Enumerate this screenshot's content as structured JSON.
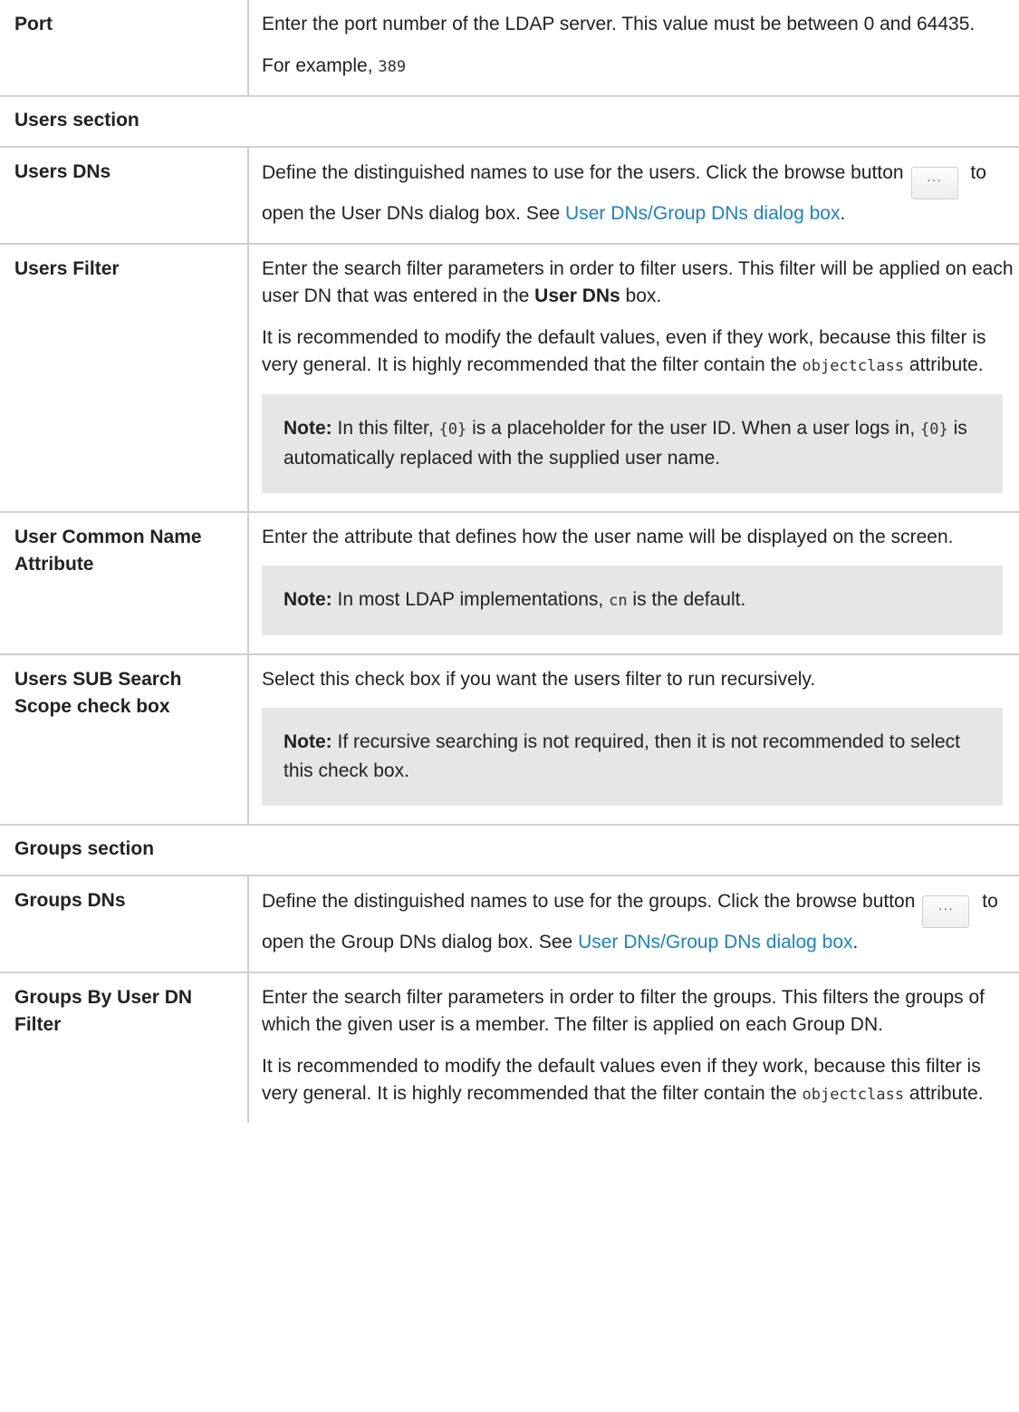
{
  "rows": {
    "port": {
      "label": "Port",
      "p1": "Enter the port number of the LDAP server. This value must be between 0 and 64435.",
      "p2_prefix": "For example, ",
      "p2_code": "389"
    },
    "users_section": {
      "label": "Users section"
    },
    "users_dns": {
      "label": "Users DNs",
      "text_a": "Define the distinguished names to use for the users. Click the browse button",
      "button_label": "···",
      "text_b": " to open the User DNs dialog box. See ",
      "link": "User DNs/Group DNs dialog box",
      "text_c": "."
    },
    "users_filter": {
      "label": "Users Filter",
      "p1_a": "Enter the search filter parameters in order to filter users. This filter will be applied on each user DN that was entered in the ",
      "p1_bold": "User DNs",
      "p1_b": " box.",
      "p2_a": "It is recommended to modify the default values, even if they work, because this filter is very general. It is highly recommended that the filter contain the ",
      "p2_code": "objectclass",
      "p2_b": " attribute.",
      "note_label": "Note:",
      "note_a": " In this filter, ",
      "note_code1": "{0}",
      "note_b": " is a placeholder for the user ID. When a user logs in, ",
      "note_code2": "{0}",
      "note_c": " is automatically replaced with the supplied user name."
    },
    "user_cn": {
      "label": "User Common Name Attribute",
      "p1": "Enter the attribute that defines how the user name will be displayed on the screen.",
      "note_label": "Note:",
      "note_a": " In most LDAP implementations, ",
      "note_code": "cn",
      "note_b": " is the default."
    },
    "users_sub": {
      "label": "Users SUB Search Scope check box",
      "p1": "Select this check box if you want the users filter to run recursively.",
      "note_label": "Note:",
      "note_text": " If recursive searching is not required, then it is not recommended to select this check box."
    },
    "groups_section": {
      "label": "Groups section"
    },
    "groups_dns": {
      "label": "Groups DNs",
      "text_a": "Define the distinguished names to use for the groups. Click the browse button",
      "button_label": "···",
      "text_b": " to open the Group DNs dialog box. See ",
      "link": "User DNs/Group DNs dialog box",
      "text_c": "."
    },
    "groups_by_user": {
      "label": "Groups By User DN Filter",
      "p1": "Enter the search filter parameters in order to filter the groups. This filters the groups of which the given user is a member. The filter is applied on each Group DN.",
      "p2_a": "It is recommended to modify the default values even if they work, because this filter is very general. It is highly recommended that the filter contain the ",
      "p2_code": "objectclass",
      "p2_b": " attribute."
    }
  }
}
